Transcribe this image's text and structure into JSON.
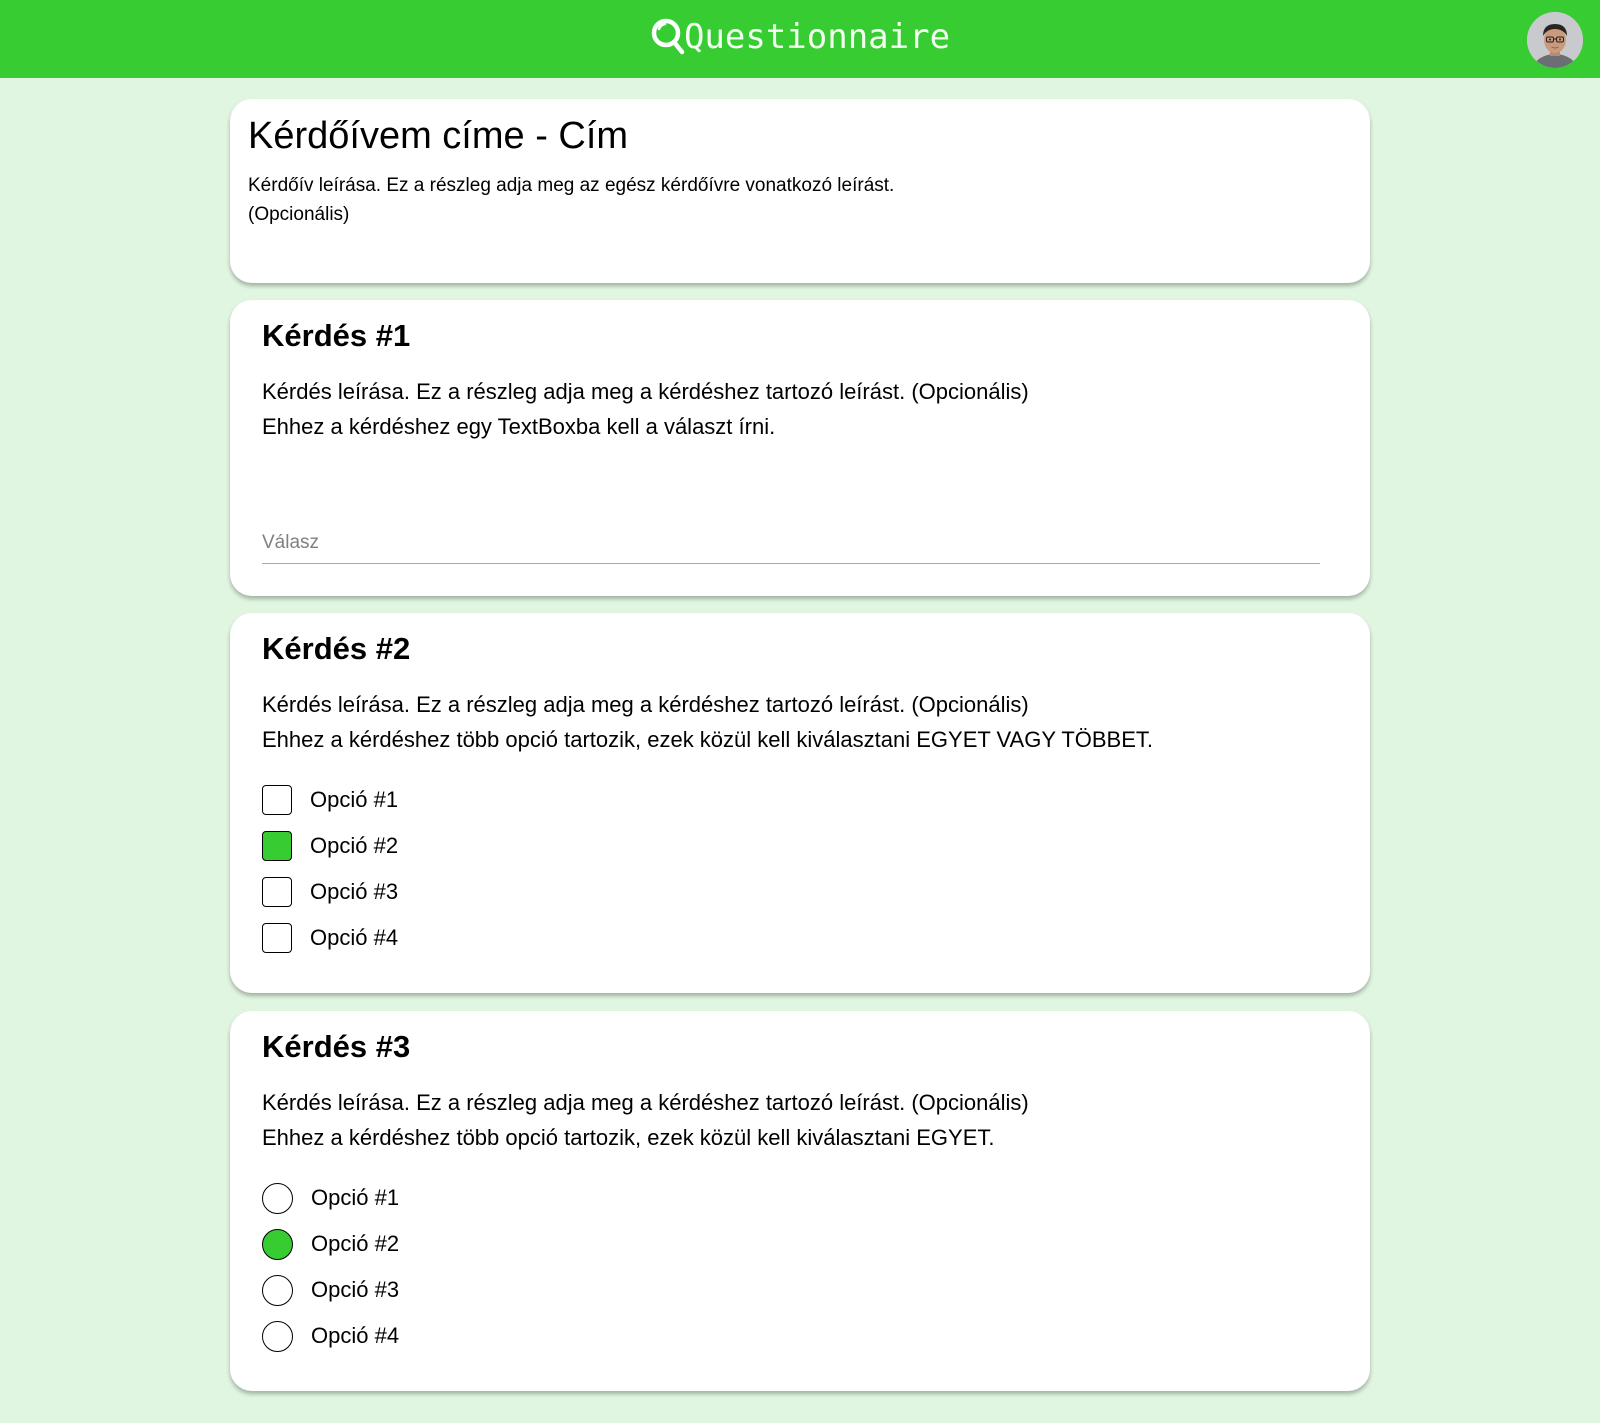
{
  "app": {
    "title": "Questionnaire",
    "accent_color": "#36cc32",
    "background_color": "#e0f6e1",
    "logo_icon": "magnifier-q-icon",
    "avatar_icon": "user-avatar"
  },
  "form": {
    "title": "Kérdőívem címe - Cím",
    "description_line1": "Kérdőív leírása. Ez a részleg adja meg az egész kérdőívre vonatkozó leírást.",
    "description_line2": "(Opcionális)"
  },
  "questions": [
    {
      "title": "Kérdés #1",
      "description": "Kérdés leírása. Ez a részleg adja meg a kérdéshez tartozó leírást. (Opcionális)",
      "hint": "Ehhez a kérdéshez egy TextBoxba kell a választ írni.",
      "type": "text",
      "answer_placeholder": "Válasz",
      "answer_value": ""
    },
    {
      "title": "Kérdés #2",
      "description": "Kérdés leírása. Ez a részleg adja meg a kérdéshez tartozó leírást. (Opcionális)",
      "hint": "Ehhez a kérdéshez több opció tartozik, ezek közül kell kiválasztani EGYET VAGY TÖBBET.",
      "type": "checkbox",
      "options": [
        {
          "label": "Opció #1",
          "selected": false
        },
        {
          "label": "Opció #2",
          "selected": true
        },
        {
          "label": "Opció #3",
          "selected": false
        },
        {
          "label": "Opció #4",
          "selected": false
        }
      ]
    },
    {
      "title": "Kérdés #3",
      "description": "Kérdés leírása. Ez a részleg adja meg a kérdéshez tartozó leírást. (Opcionális)",
      "hint": "Ehhez a kérdéshez több opció tartozik, ezek közül kell kiválasztani EGYET.",
      "type": "radio",
      "options": [
        {
          "label": "Opció #1",
          "selected": false
        },
        {
          "label": "Opció #2",
          "selected": true
        },
        {
          "label": "Opció #3",
          "selected": false
        },
        {
          "label": "Opció #4",
          "selected": false
        }
      ]
    }
  ]
}
